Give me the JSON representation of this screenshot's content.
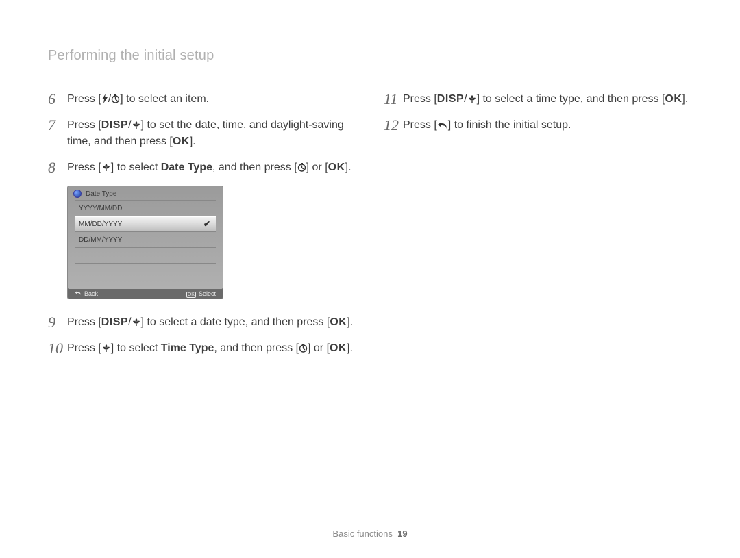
{
  "page_title": "Performing the initial setup",
  "footer": {
    "section": "Basic functions",
    "page_number": "19"
  },
  "icons": {
    "flash": "⚡",
    "timer": "🕒",
    "disp": "DISP",
    "macro": "❀",
    "ok": "OK",
    "back": "↶",
    "check": "✔"
  },
  "lcd": {
    "title": "Date Type",
    "options": [
      "YYYY/MM/DD",
      "MM/DD/YYYY",
      "DD/MM/YYYY"
    ],
    "selected_index": 1,
    "footer": {
      "back_label": "Back",
      "select_label": "Select"
    }
  },
  "left_steps": [
    {
      "num": "6",
      "parts": [
        {
          "t": "Press ["
        },
        {
          "icon": "flash"
        },
        {
          "t": "/"
        },
        {
          "icon": "timer"
        },
        {
          "t": "] to select an item."
        }
      ]
    },
    {
      "num": "7",
      "parts": [
        {
          "t": "Press ["
        },
        {
          "icon": "disp"
        },
        {
          "t": "/"
        },
        {
          "icon": "macro"
        },
        {
          "t": "] to set the date, time, and daylight-saving time, and then press ["
        },
        {
          "icon": "ok"
        },
        {
          "t": "]."
        }
      ]
    },
    {
      "num": "8",
      "parts": [
        {
          "t": "Press ["
        },
        {
          "icon": "macro"
        },
        {
          "t": "] to select "
        },
        {
          "bold": "Date Type"
        },
        {
          "t": ", and then press ["
        },
        {
          "icon": "timer"
        },
        {
          "t": "] or ["
        },
        {
          "icon": "ok"
        },
        {
          "t": "]."
        }
      ]
    },
    {
      "num": "9",
      "parts": [
        {
          "t": "Press ["
        },
        {
          "icon": "disp"
        },
        {
          "t": "/"
        },
        {
          "icon": "macro"
        },
        {
          "t": "] to select a date type, and then press ["
        },
        {
          "icon": "ok"
        },
        {
          "t": "]."
        }
      ]
    },
    {
      "num": "10",
      "parts": [
        {
          "t": "Press ["
        },
        {
          "icon": "macro"
        },
        {
          "t": "] to select "
        },
        {
          "bold": "Time Type"
        },
        {
          "t": ", and then press ["
        },
        {
          "icon": "timer"
        },
        {
          "t": "] or ["
        },
        {
          "icon": "ok"
        },
        {
          "t": "]."
        }
      ]
    }
  ],
  "right_steps": [
    {
      "num": "11",
      "parts": [
        {
          "t": "Press ["
        },
        {
          "icon": "disp"
        },
        {
          "t": "/"
        },
        {
          "icon": "macro"
        },
        {
          "t": "] to select a time type, and then press ["
        },
        {
          "icon": "ok"
        },
        {
          "t": "]."
        }
      ]
    },
    {
      "num": "12",
      "parts": [
        {
          "t": "Press ["
        },
        {
          "icon": "back"
        },
        {
          "t": "] to finish the initial setup."
        }
      ]
    }
  ]
}
